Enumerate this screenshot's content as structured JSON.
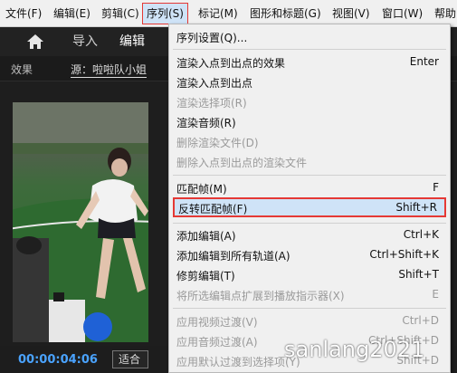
{
  "menubar": {
    "items": [
      "文件(F)",
      "编辑(E)",
      "剪辑(C)",
      "序列(S)",
      "标记(M)",
      "图形和标题(G)",
      "视图(V)",
      "窗口(W)",
      "帮助"
    ]
  },
  "toolbar": {
    "home_icon": "home-icon",
    "import": "导入",
    "edit": "编辑"
  },
  "panel": {
    "effects": "效果",
    "source": "源：啦啦队小姐"
  },
  "bottom": {
    "timecode": "00:00:04:06",
    "fit": "适合"
  },
  "sequence_menu": {
    "items": [
      {
        "label": "序列设置(Q)...",
        "shortcut": ""
      },
      {
        "label": "渲染入点到出点的效果",
        "shortcut": "Enter"
      },
      {
        "label": "渲染入点到出点",
        "shortcut": ""
      },
      {
        "label": "渲染选择项(R)",
        "shortcut": ""
      },
      {
        "label": "渲染音频(R)",
        "shortcut": ""
      },
      {
        "label": "删除渲染文件(D)",
        "shortcut": ""
      },
      {
        "label": "删除入点到出点的渲染文件",
        "shortcut": ""
      },
      {
        "label": "匹配帧(M)",
        "shortcut": "F"
      },
      {
        "label": "反转匹配帧(F)",
        "shortcut": "Shift+R"
      },
      {
        "label": "添加编辑(A)",
        "shortcut": "Ctrl+K"
      },
      {
        "label": "添加编辑到所有轨道(A)",
        "shortcut": "Ctrl+Shift+K"
      },
      {
        "label": "修剪编辑(T)",
        "shortcut": "Shift+T"
      },
      {
        "label": "将所选编辑点扩展到播放指示器(X)",
        "shortcut": "E"
      },
      {
        "label": "应用视频过渡(V)",
        "shortcut": "Ctrl+D"
      },
      {
        "label": "应用音频过渡(A)",
        "shortcut": "Ctrl+Shift+D"
      },
      {
        "label": "应用默认过渡到选择项(Y)",
        "shortcut": "Shift+D"
      }
    ]
  },
  "watermark": "sanlang2021",
  "colors": {
    "highlight_border": "#e53935",
    "highlight_fill": "#cfe3f7",
    "timecode": "#4aa3ff"
  }
}
